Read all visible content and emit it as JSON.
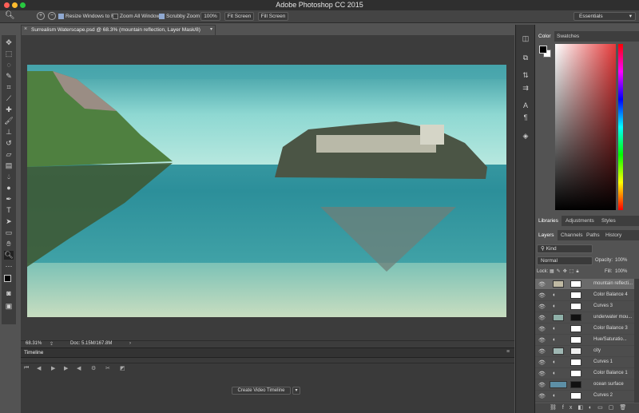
{
  "app": {
    "title": "Adobe Photoshop CC 2015"
  },
  "options_bar": {
    "resize_windows": "Resize Windows to Fit",
    "zoom_all": "Zoom All Windows",
    "scrubby": "Scrubby Zoom",
    "zoom_value": "100%",
    "fit_screen": "Fit Screen",
    "fill_screen": "Fill Screen",
    "workspace": "Essentials"
  },
  "document": {
    "tab_title": "Surrealism Waterscape.psd @ 68.3% (mountain reflection, Layer Mask/8)",
    "zoom": "68.31%",
    "doc_size": "Doc: 5.15M/167.8M"
  },
  "timeline": {
    "title": "Timeline",
    "create_button": "Create Video Timeline"
  },
  "color_panel": {
    "tabs": [
      "Color",
      "Swatches"
    ]
  },
  "libraries_panel": {
    "tabs": [
      "Libraries",
      "Adjustments",
      "Styles"
    ]
  },
  "layers_panel": {
    "tabs": [
      "Layers",
      "Channels",
      "Paths",
      "History"
    ],
    "filter_kind": "Kind",
    "blend_mode": "Normal",
    "opacity_label": "Opacity:",
    "opacity_value": "100%",
    "lock_label": "Lock:",
    "fill_label": "Fill:",
    "fill_value": "100%",
    "layers": [
      {
        "name": "mountain reflecti..."
      },
      {
        "name": "Color Balance 4"
      },
      {
        "name": "Curves 3"
      },
      {
        "name": "underwater mou..."
      },
      {
        "name": "Color Balance 3"
      },
      {
        "name": "Hue/Saturatio..."
      },
      {
        "name": "city"
      },
      {
        "name": "Curves 1"
      },
      {
        "name": "Color Balance 1"
      },
      {
        "name": "ocean surface"
      },
      {
        "name": "Curves 2"
      }
    ]
  },
  "colors": {
    "foreground": "#000000",
    "background": "#ffffff",
    "accent": "#8fa8d0"
  }
}
